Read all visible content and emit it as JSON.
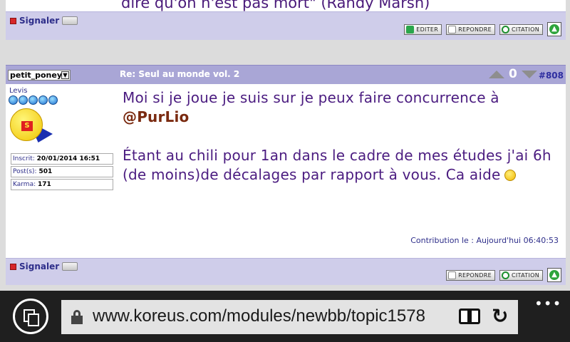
{
  "previous_post": {
    "text": "dire qu'on n'est pas mort\" (Randy Marsh)",
    "report_label": "Signaler",
    "buttons": {
      "edit": "EDITER",
      "reply": "REPONDRE",
      "quote": "CITATION"
    }
  },
  "post": {
    "username_select": "petit_poney",
    "title": "Re: Seul au monde vol. 2",
    "vote_count": "0",
    "post_number": "#808",
    "author": {
      "name": "Levis",
      "star_count": 5,
      "stats": [
        {
          "label": "Inscrit:",
          "value": "20/01/2014 16:51"
        },
        {
          "label": "Post(s):",
          "value": "501"
        },
        {
          "label": "Karma:",
          "value": "171"
        }
      ]
    },
    "body": {
      "line1_before": "Moi si je joue je suis sur je peux faire concurrence à",
      "mention": "@PurLio",
      "paragraph2": "Étant au chili pour 1an dans le cadre de mes études j'ai 6h (de moins)de décalages par rapport à vous. Ca aide"
    },
    "contribution": "Contribution le : Aujourd'hui 06:40:53",
    "report_label": "Signaler",
    "buttons": {
      "reply": "REPONDRE",
      "quote": "CITATION"
    }
  },
  "browser": {
    "url": "www.koreus.com/modules/newbb/topic1578",
    "more_label": "•••"
  }
}
